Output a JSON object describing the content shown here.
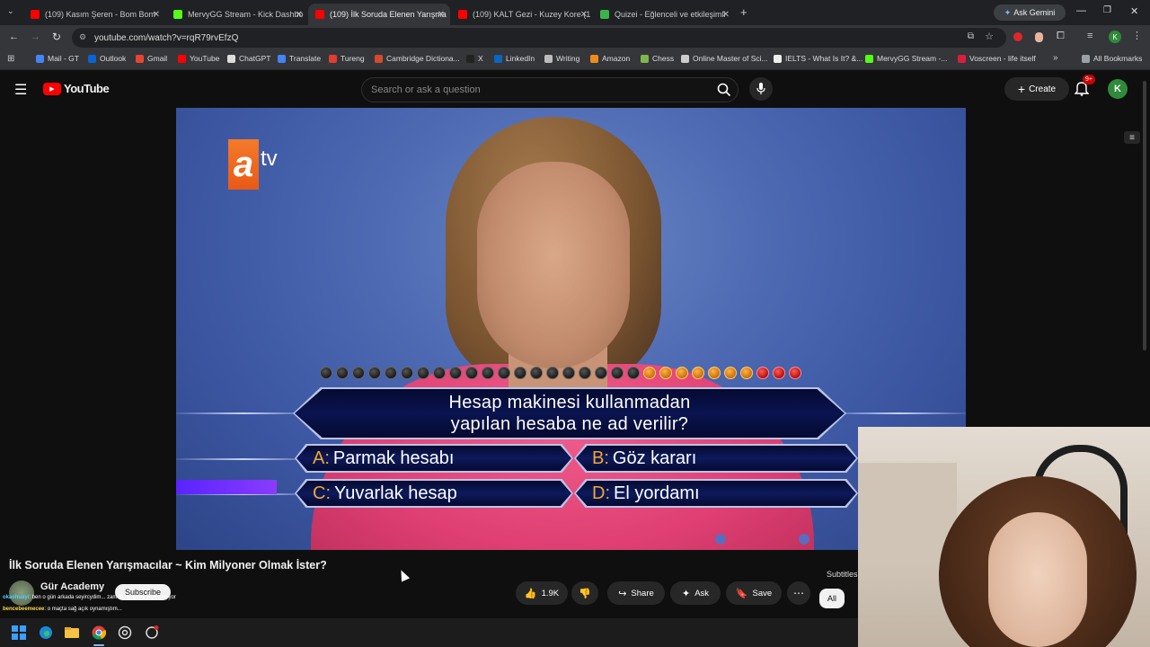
{
  "browser": {
    "tabs": [
      {
        "label": "(109) Kasım Şeren - Bom Bom",
        "color": "#ff0000"
      },
      {
        "label": "MervyGG Stream - Kick Dashbo",
        "color": "#53fc18"
      },
      {
        "label": "(109) İlk Soruda Elenen Yarışma",
        "color": "#ff0000",
        "active": true
      },
      {
        "label": "(109) KALT Gezi - Kuzey Kore (1",
        "color": "#ff0000"
      },
      {
        "label": "Quizei - Eğlenceli ve etkileşimli",
        "color": "#3cb34a"
      }
    ],
    "ask_gemini": "Ask Gemini",
    "url": "youtube.com/watch?v=rqR79rvEfzQ",
    "bookmarks": [
      "Mail - GT",
      "Outlook",
      "Gmail",
      "YouTube",
      "ChatGPT",
      "Translate",
      "Tureng",
      "Cambridge Dictiona...",
      "X",
      "LinkedIn",
      "Writing",
      "Amazon",
      "Chess",
      "Online Master of Sci...",
      "IELTS - What Is It? &...",
      "MervyGG Stream -...",
      "Voscreen - life itself"
    ],
    "all_bookmarks": "All Bookmarks"
  },
  "youtube": {
    "logo": "YouTube",
    "search_placeholder": "Search or ask a question",
    "create": "Create",
    "notif_badge": "9+",
    "avatar_letter": "K"
  },
  "quiz": {
    "channel_logo_a": "a",
    "channel_logo_tv": "tv",
    "question_line1": "Hesap makinesi kullanmadan",
    "question_line2": "yapılan hesaba ne ad verilir?",
    "answers": [
      {
        "letter": "A:",
        "text": "Parmak hesabı"
      },
      {
        "letter": "B:",
        "text": "Göz kararı"
      },
      {
        "letter": "C:",
        "text": "Yuvarlak hesap"
      },
      {
        "letter": "D:",
        "text": "El yordamı"
      }
    ],
    "money_ladder": {
      "total": 30,
      "orange_from": 20,
      "red_from": 27
    }
  },
  "video_info": {
    "title": "İlk Soruda Elenen Yarışmacılar ~ Kim Milyoner Olmak İster?",
    "channel": "Gür Academy",
    "subscribe": "Subscribe",
    "likes": "1.9K",
    "share": "Share",
    "ask": "Ask",
    "save": "Save",
    "subtitles": "Subtitles",
    "all_chip": "All"
  },
  "chat": [
    {
      "user": "okashuayi",
      "msg": ": ben o gün arkada seyircydim... zaman ne kadar hızlı geçiyor"
    },
    {
      "user": "bencebeemecee",
      "msg": ": o maçta sağ açık oynamıştım..."
    }
  ]
}
